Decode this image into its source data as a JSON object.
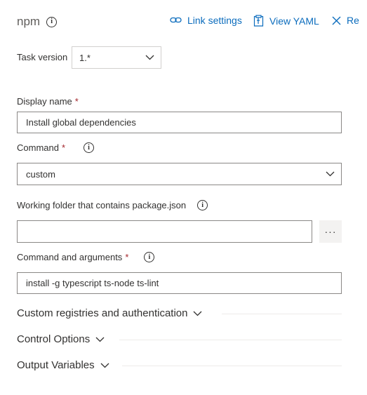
{
  "header": {
    "title": "npm",
    "link_settings": "Link settings",
    "view_yaml": "View YAML",
    "remove": "Re"
  },
  "task_version": {
    "label": "Task version",
    "value": "1.*"
  },
  "display_name": {
    "label": "Display name",
    "required_mark": "*",
    "value": "Install global dependencies"
  },
  "command": {
    "label": "Command",
    "required_mark": "*",
    "value": "custom"
  },
  "working_folder": {
    "label": "Working folder that contains package.json",
    "value": "",
    "browse_label": "···"
  },
  "command_args": {
    "label": "Command and arguments",
    "required_mark": "*",
    "value": "install -g typescript ts-node ts-lint"
  },
  "sections": [
    "Custom registries and authentication",
    "Control Options",
    "Output Variables"
  ],
  "icons": {
    "info": "info-icon",
    "link": "link-icon",
    "yaml": "clipboard-icon",
    "close": "close-icon",
    "chevron": "chevron-down-icon"
  },
  "colors": {
    "accent": "#0b6cbd",
    "required": "#a4262c",
    "text": "#323130"
  }
}
